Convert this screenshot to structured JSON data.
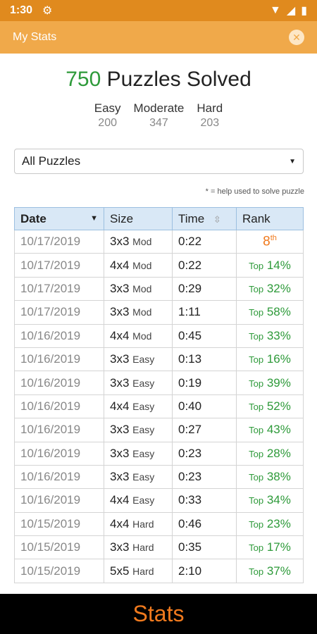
{
  "status_bar": {
    "time": "1:30"
  },
  "app_bar": {
    "title": "My Stats",
    "close_icon": "close-icon"
  },
  "summary": {
    "count": "750",
    "label": "Puzzles Solved",
    "levels": [
      {
        "label": "Easy",
        "value": "200"
      },
      {
        "label": "Moderate",
        "value": "347"
      },
      {
        "label": "Hard",
        "value": "203"
      }
    ]
  },
  "filter": {
    "selected": "All Puzzles"
  },
  "help_note": "* = help used to solve puzzle",
  "table": {
    "headers": [
      "Date",
      "Size",
      "Time",
      "Rank"
    ],
    "rows": [
      {
        "date": "10/17/2019",
        "grid": "3x3",
        "level": "Mod",
        "time": "0:22",
        "rank_prefix": "",
        "rank": "8",
        "rank_suffix": "th"
      },
      {
        "date": "10/17/2019",
        "grid": "4x4",
        "level": "Mod",
        "time": "0:22",
        "rank_prefix": "Top",
        "rank": "14%"
      },
      {
        "date": "10/17/2019",
        "grid": "3x3",
        "level": "Mod",
        "time": "0:29",
        "rank_prefix": "Top",
        "rank": "32%"
      },
      {
        "date": "10/17/2019",
        "grid": "3x3",
        "level": "Mod",
        "time": "1:11",
        "rank_prefix": "Top",
        "rank": "58%"
      },
      {
        "date": "10/16/2019",
        "grid": "4x4",
        "level": "Mod",
        "time": "0:45",
        "rank_prefix": "Top",
        "rank": "33%"
      },
      {
        "date": "10/16/2019",
        "grid": "3x3",
        "level": "Easy",
        "time": "0:13",
        "rank_prefix": "Top",
        "rank": "16%"
      },
      {
        "date": "10/16/2019",
        "grid": "3x3",
        "level": "Easy",
        "time": "0:19",
        "rank_prefix": "Top",
        "rank": "39%"
      },
      {
        "date": "10/16/2019",
        "grid": "4x4",
        "level": "Easy",
        "time": "0:40",
        "rank_prefix": "Top",
        "rank": "52%"
      },
      {
        "date": "10/16/2019",
        "grid": "3x3",
        "level": "Easy",
        "time": "0:27",
        "rank_prefix": "Top",
        "rank": "43%"
      },
      {
        "date": "10/16/2019",
        "grid": "3x3",
        "level": "Easy",
        "time": "0:23",
        "rank_prefix": "Top",
        "rank": "28%"
      },
      {
        "date": "10/16/2019",
        "grid": "3x3",
        "level": "Easy",
        "time": "0:23",
        "rank_prefix": "Top",
        "rank": "38%"
      },
      {
        "date": "10/16/2019",
        "grid": "4x4",
        "level": "Easy",
        "time": "0:33",
        "rank_prefix": "Top",
        "rank": "34%"
      },
      {
        "date": "10/15/2019",
        "grid": "4x4",
        "level": "Hard",
        "time": "0:46",
        "rank_prefix": "Top",
        "rank": "23%"
      },
      {
        "date": "10/15/2019",
        "grid": "3x3",
        "level": "Hard",
        "time": "0:35",
        "rank_prefix": "Top",
        "rank": "17%"
      },
      {
        "date": "10/15/2019",
        "grid": "5x5",
        "level": "Hard",
        "time": "2:10",
        "rank_prefix": "Top",
        "rank": "37%"
      }
    ]
  },
  "bottom_bar": {
    "label": "Stats"
  },
  "colors": {
    "accent": "#f0a94a",
    "status": "#e08a1e",
    "count_green": "#2e9a3a",
    "highlight_orange": "#f07a1e"
  }
}
